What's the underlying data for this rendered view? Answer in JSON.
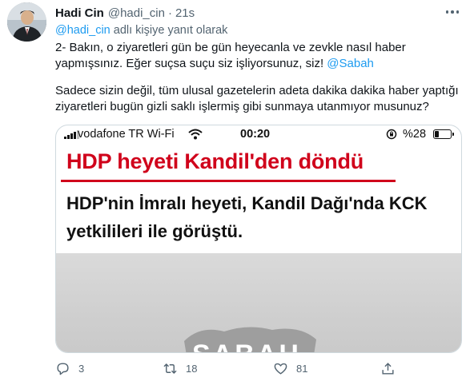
{
  "tweet": {
    "author_name": "Hadi Cin",
    "author_handle": "@hadi_cin",
    "separator": "·",
    "time": "21s",
    "reply_to": {
      "mention": "@hadi_cin",
      "suffix": " adlı kişiye yanıt olarak"
    },
    "text": {
      "line1": "2- Bakın, o ziyaretleri gün be gün heyecanla ve zevkle nasıl haber",
      "line2_prefix": "yapmışsınız. Eğer suçsa suçu siz işliyorsunuz, siz! ",
      "line2_mention": "@Sabah",
      "line3": "Sadece sizin değil, tüm ulusal gazetelerin adeta dakika dakika haber yaptığı",
      "line4": "ziyaretleri bugün gizli saklı işlermiş gibi sunmaya utanmıyor musunuz?"
    },
    "media": {
      "statusbar": {
        "carrier": "vodafone TR Wi-Fi",
        "clock": "00:20",
        "battery_pct": "%28",
        "battery_level": 0.28
      },
      "headline": "HDP heyeti Kandil'den döndü",
      "subhead": "HDP'nin İmralı heyeti, Kandil Dağı'nda KCK yetkilileri ile görüştü.",
      "watermark": "SABAH"
    },
    "actions": {
      "replies": "3",
      "retweets": "18",
      "likes": "81"
    },
    "colors": {
      "link": "#1d9bf0",
      "muted": "#536471",
      "headline_red": "#d0021b"
    }
  }
}
